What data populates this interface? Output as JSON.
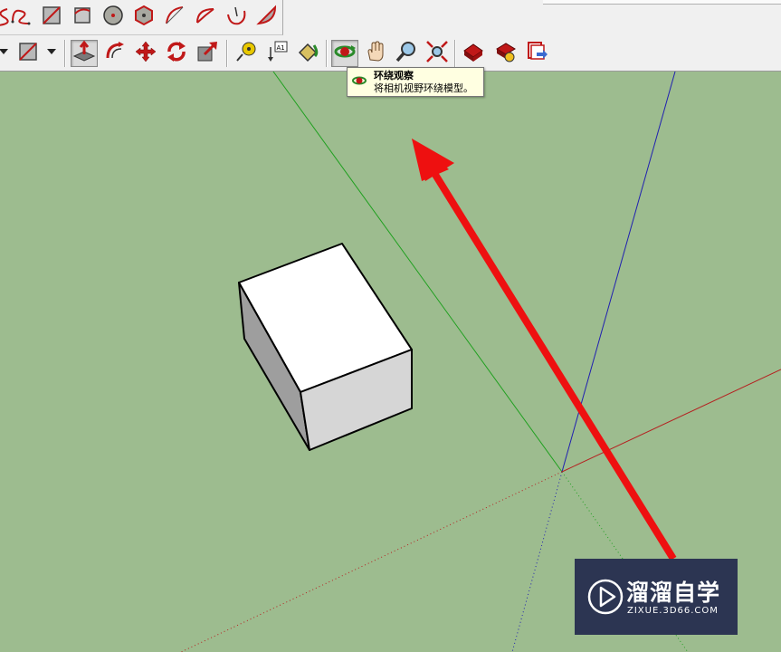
{
  "tooltip": {
    "title": "环绕观察",
    "description": "将相机视野环绕模型。"
  },
  "watermark": {
    "brand": "溜溜自学",
    "url": "ZIXUE.3D66.COM"
  },
  "colors": {
    "viewport_background": "#9dbc8f",
    "axis_red": "#b52020",
    "axis_green": "#20a020",
    "axis_blue": "#2020b0",
    "arrow": "#ee1010"
  },
  "toolbar": {
    "row1": [
      "freehand-icon",
      "rectangle-icon",
      "rotated-rectangle-icon",
      "circle-icon",
      "polygon-icon",
      "arc-icon",
      "pie-icon",
      "two-point-arc-icon",
      "three-point-arc-icon"
    ],
    "row2": [
      "eraser-icon",
      "push-pull-icon",
      "offset-icon",
      "move-icon",
      "rotate-icon",
      "scale-icon",
      "tape-measure-icon",
      "text-icon",
      "paint-bucket-icon",
      "orbit-icon",
      "pan-icon",
      "zoom-icon",
      "zoom-extents-icon",
      "warehouse-icon",
      "extension-warehouse-icon",
      "layout-send-icon"
    ],
    "active_tool": "orbit-icon"
  }
}
